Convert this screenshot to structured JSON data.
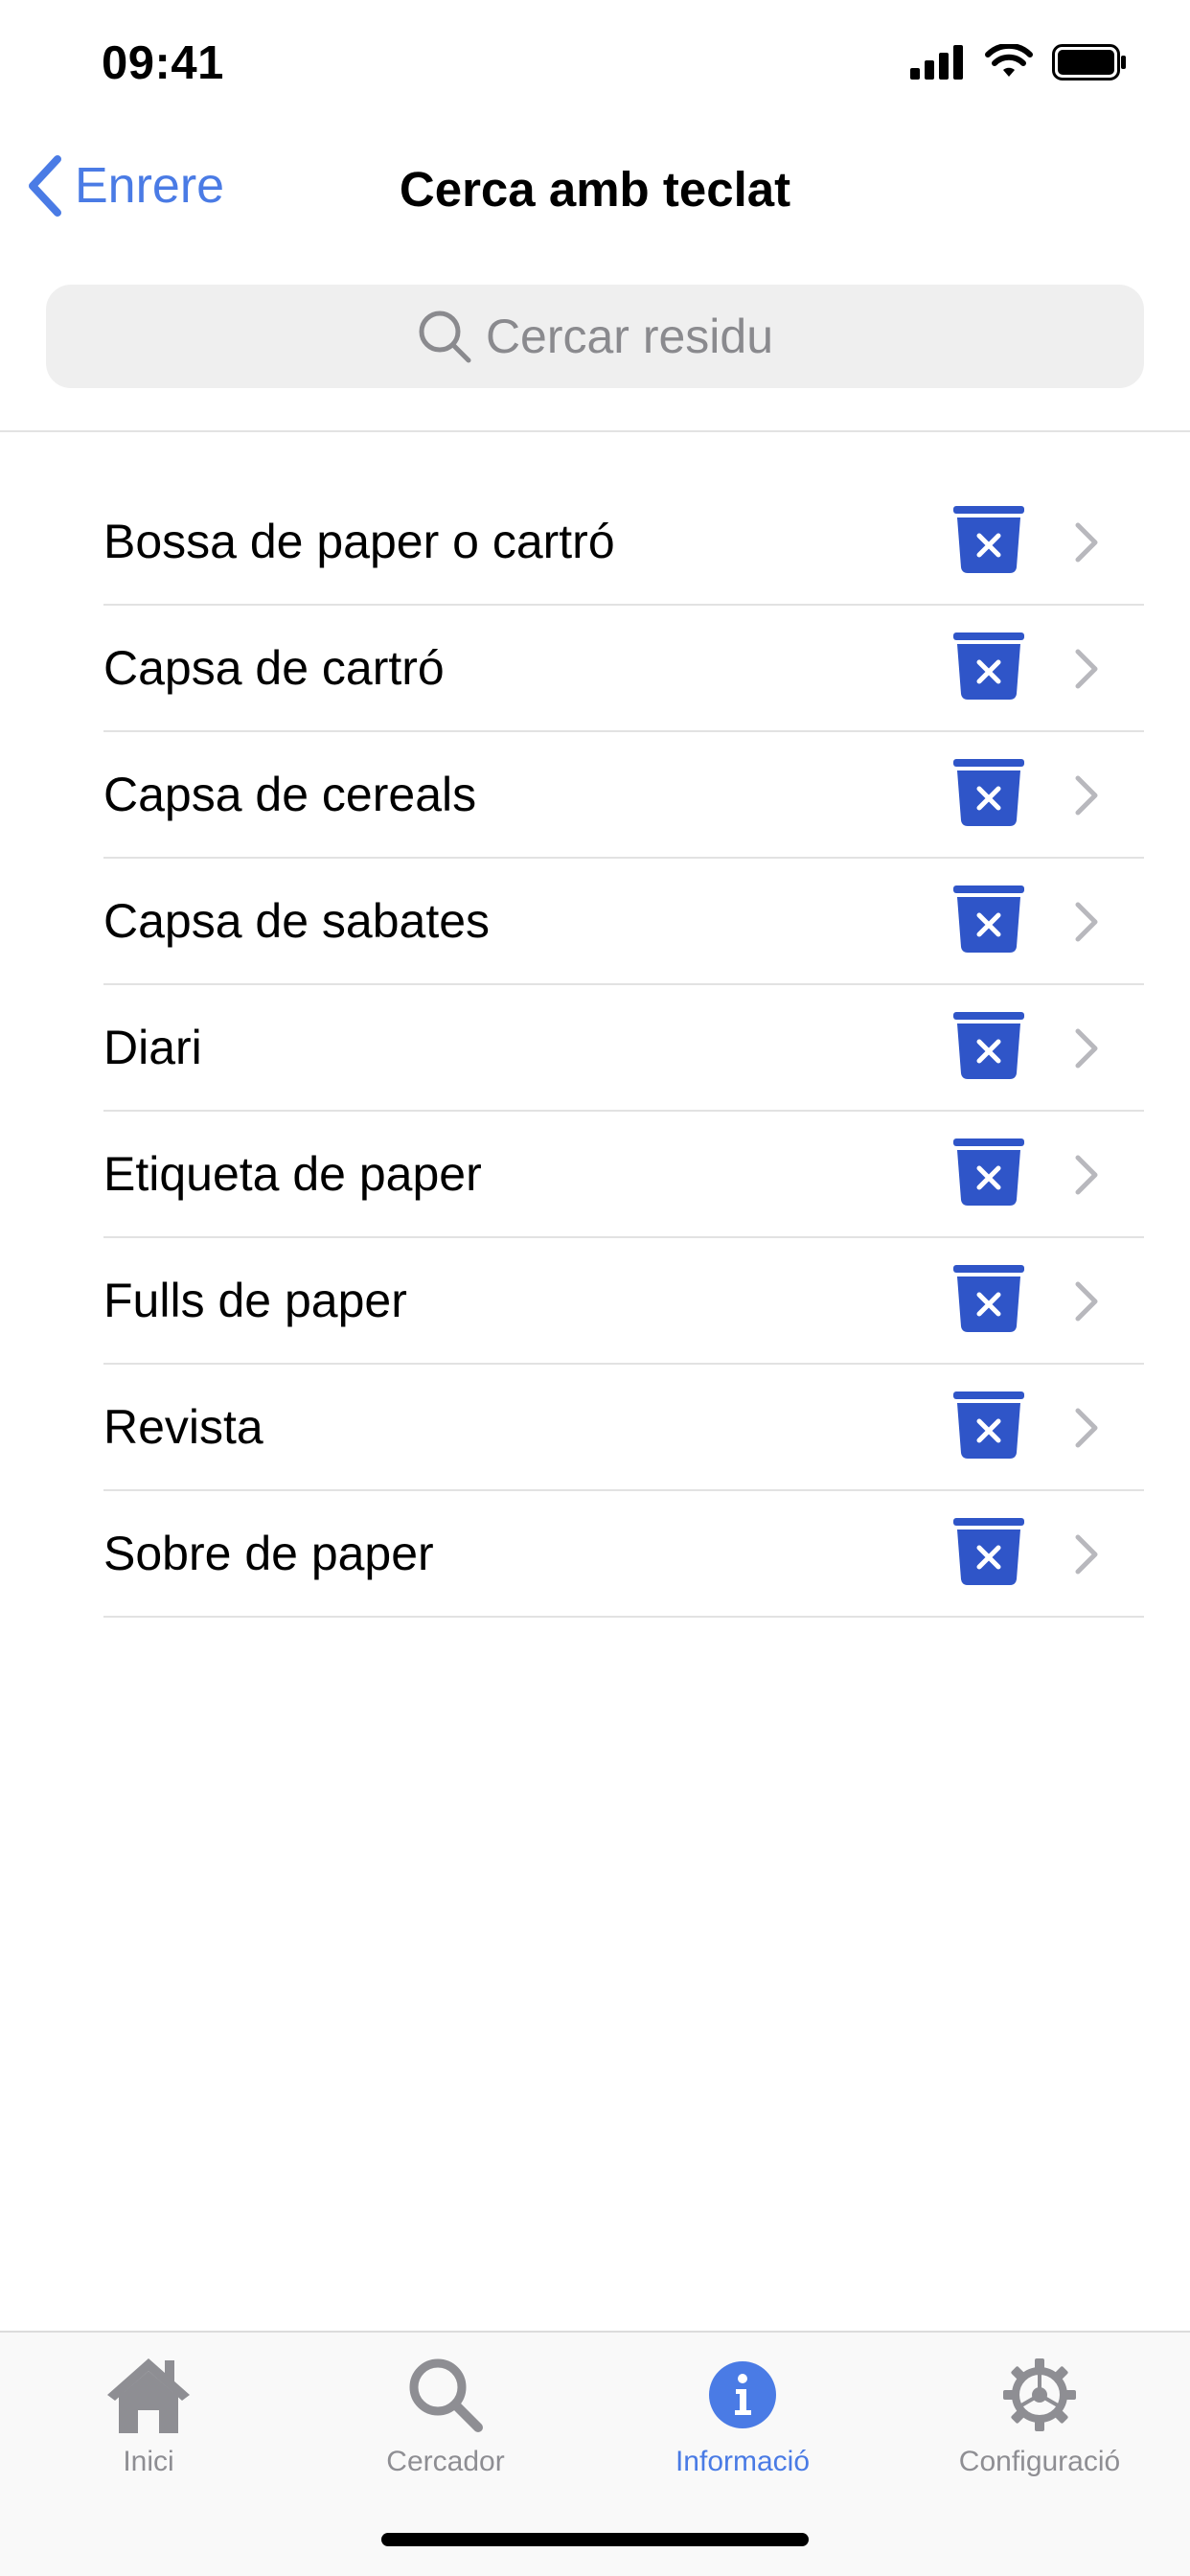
{
  "status_bar": {
    "time": "09:41"
  },
  "nav": {
    "back_label": "Enrere",
    "title": "Cerca amb teclat"
  },
  "search": {
    "placeholder": "Cercar residu"
  },
  "items": [
    {
      "label": "Bossa de paper o cartró",
      "icon": "blue-bin-icon"
    },
    {
      "label": "Capsa de cartró",
      "icon": "blue-bin-icon"
    },
    {
      "label": "Capsa de cereals",
      "icon": "blue-bin-icon"
    },
    {
      "label": "Capsa de sabates",
      "icon": "blue-bin-icon"
    },
    {
      "label": "Diari",
      "icon": "blue-bin-icon"
    },
    {
      "label": "Etiqueta de paper",
      "icon": "blue-bin-icon"
    },
    {
      "label": "Fulls de paper",
      "icon": "blue-bin-icon"
    },
    {
      "label": "Revista",
      "icon": "blue-bin-icon"
    },
    {
      "label": "Sobre de paper",
      "icon": "blue-bin-icon"
    }
  ],
  "tabs": [
    {
      "label": "Inici",
      "icon": "home-icon",
      "active": false
    },
    {
      "label": "Cercador",
      "icon": "search-icon",
      "active": false
    },
    {
      "label": "Informació",
      "icon": "info-icon",
      "active": true
    },
    {
      "label": "Configuració",
      "icon": "gear-icon",
      "active": false
    }
  ],
  "colors": {
    "accent": "#4a7be5",
    "bin_blue": "#2f55c8",
    "inactive": "#8e8e93"
  }
}
